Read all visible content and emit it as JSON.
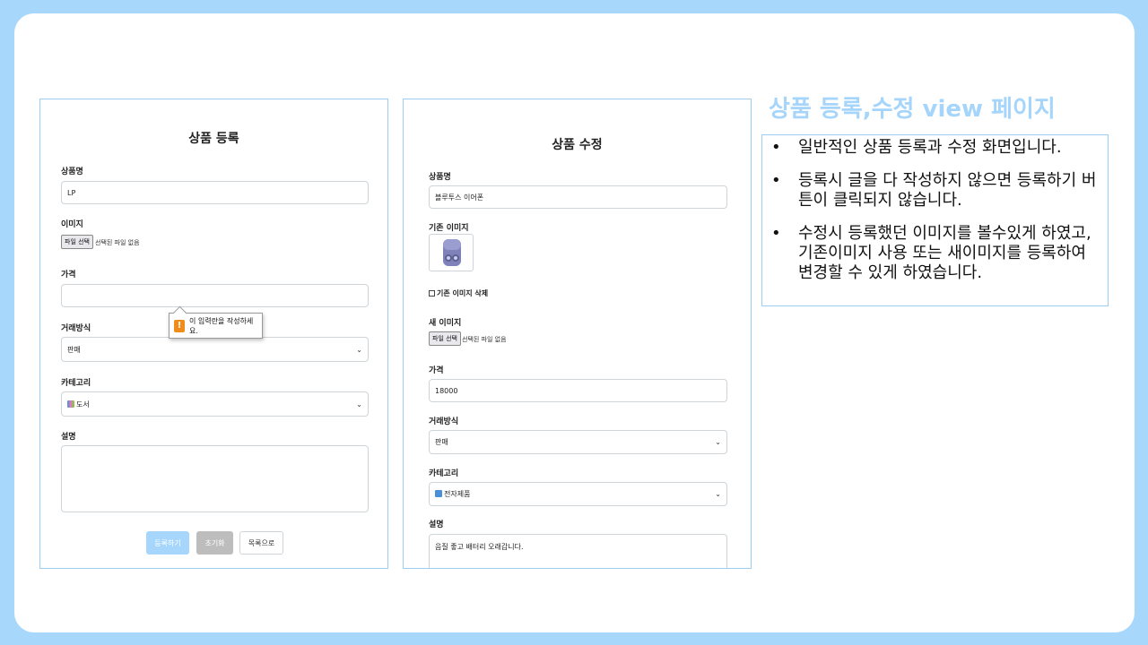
{
  "slide": {
    "heading": "상품 등록,수정 view 페이지",
    "notes": [
      "일반적인 상품 등록과 수정 화면입니다.",
      "등록시 글을 다 작성하지 않으면 등록하기 버튼이 클릭되지 않습니다.",
      "수정시 등록했던 이미지를 볼수있게 하였고, 기존이미지 사용 또는 새이미지를 등록하여 변경할 수 있게 하였습니다."
    ]
  },
  "register_form": {
    "title": "상품 등록",
    "name_label": "상품명",
    "name_value": "LP",
    "image_label": "이미지",
    "file_button": "파일 선택",
    "file_status": "선택된 파일 없음",
    "price_label": "가격",
    "price_value": "",
    "validation_message": "이 입력란을 작성하세요.",
    "trade_label": "거래방식",
    "trade_value": "판매",
    "category_label": "카테고리",
    "category_value": "도서",
    "desc_label": "설명",
    "desc_value": "",
    "submit_button": "등록하기",
    "reset_button": "초기화",
    "list_button": "목록으로"
  },
  "edit_form": {
    "title": "상품 수정",
    "name_label": "상품명",
    "name_value": "블루투스 이어폰",
    "existing_image_label": "기존 이미지",
    "delete_image_label": "기존 이미지 삭제",
    "new_image_label": "새 이미지",
    "file_button": "파일 선택",
    "file_status": "선택된 파일 없음",
    "price_label": "가격",
    "price_value": "18000",
    "trade_label": "거래방식",
    "trade_value": "판매",
    "category_label": "카테고리",
    "category_value": "전자제품",
    "desc_label": "설명",
    "desc_value": "음질 좋고 배터리 오래갑니다."
  },
  "colors": {
    "background": "#a7d8fb",
    "heading": "#a6d5fb",
    "panel_border": "#9dcdf0",
    "submit_button": "#a6d6fb",
    "reset_button": "#bdbdbd",
    "warning": "#f08c1c"
  }
}
